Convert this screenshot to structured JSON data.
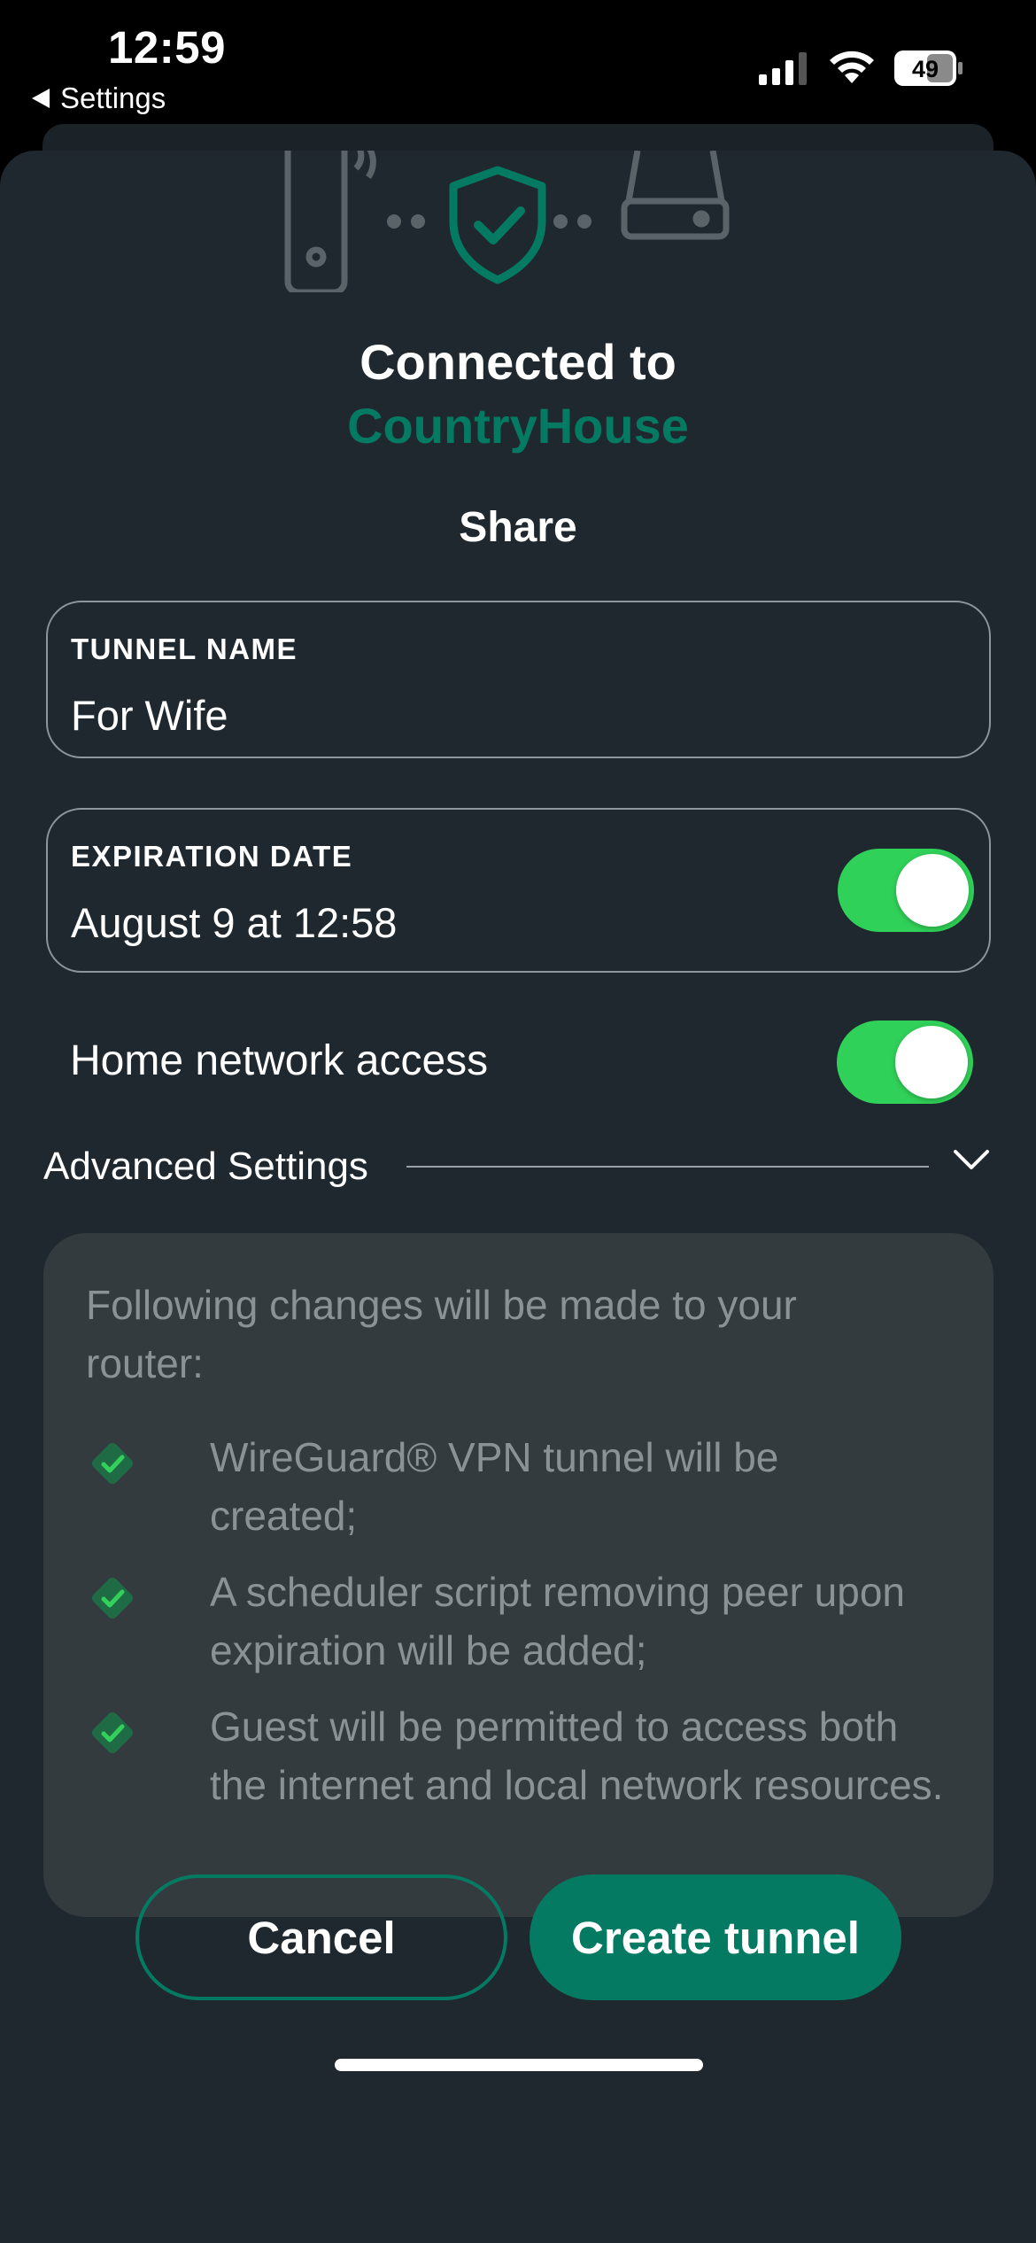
{
  "status_bar": {
    "time": "12:59",
    "back_label": "Settings",
    "battery": "49"
  },
  "header": {
    "connected_prefix": "Connected to",
    "router_name": "CountryHouse",
    "title": "Share"
  },
  "tunnel_name": {
    "label": "TUNNEL NAME",
    "value": "For Wife"
  },
  "expiration": {
    "label": "EXPIRATION DATE",
    "value": "August 9 at 12:58",
    "enabled": true
  },
  "home_network": {
    "label": "Home network access",
    "enabled": true
  },
  "advanced": {
    "label": "Advanced Settings"
  },
  "info": {
    "intro": "Following changes will be made to your router:",
    "items": [
      "WireGuard® VPN tunnel will be created;",
      "A scheduler script removing peer upon expiration will be added;",
      "Guest will be permitted to access both the internet and local network resources."
    ]
  },
  "actions": {
    "cancel": "Cancel",
    "create": "Create tunnel"
  },
  "colors": {
    "accent": "#047a62",
    "toggle_on": "#30d158",
    "sheet_bg": "#1f282e",
    "card_bg": "#343b3f",
    "muted_text": "#8b9296"
  }
}
